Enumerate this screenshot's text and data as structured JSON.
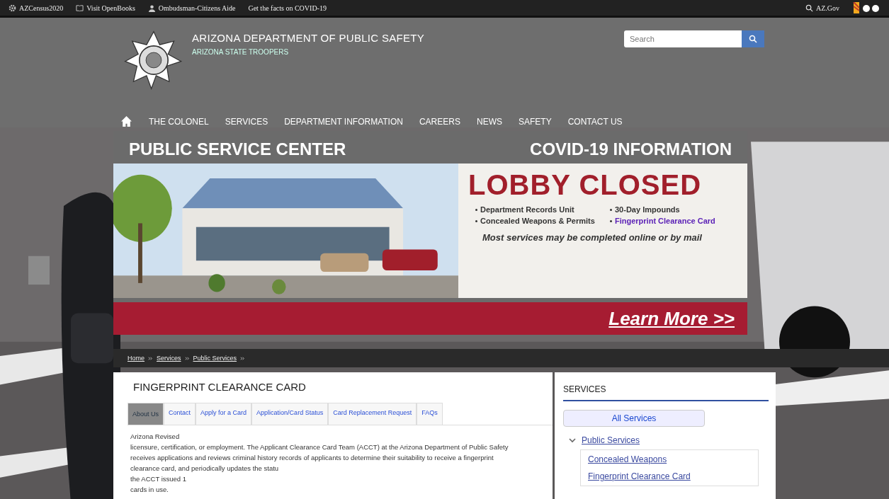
{
  "top_bar": {
    "links": [
      {
        "label": "AZCensus2020"
      },
      {
        "label": "Visit OpenBooks"
      },
      {
        "label": "Ombudsman-Citizens Aide"
      },
      {
        "label": "Get the facts on COVID-19"
      }
    ],
    "right_link": "AZ.Gov"
  },
  "header": {
    "title": "ARIZONA DEPARTMENT OF PUBLIC SAFETY",
    "subtitle": "ARIZONA STATE TROOPERS",
    "search": {
      "placeholder": "Search"
    }
  },
  "nav": {
    "items": [
      "THE COLONEL",
      "SERVICES",
      "DEPARTMENT INFORMATION",
      "CAREERS",
      "NEWS",
      "SAFETY",
      "CONTACT US"
    ]
  },
  "banner": {
    "left_heading": "PUBLIC SERVICE CENTER",
    "right_heading": "COVID-19 INFORMATION",
    "notice": "LOBBY CLOSED",
    "bullets": [
      {
        "text": "Department Records Unit",
        "highlight": false
      },
      {
        "text": "30-Day Impounds",
        "highlight": false
      },
      {
        "text": "Concealed Weapons & Permits",
        "highlight": false
      },
      {
        "text": "Fingerprint Clearance Card",
        "highlight": true
      }
    ],
    "note": "Most services may be completed online or by mail",
    "button": "Learn More >>"
  },
  "breadcrumb": [
    "Home",
    "Services",
    "Public Services"
  ],
  "content": {
    "title": "FINGERPRINT CLEARANCE CARD",
    "tabs": [
      {
        "label": "About Us",
        "selected": true
      },
      {
        "label": "Contact",
        "selected": false
      },
      {
        "label": "Apply for a Card",
        "selected": false
      },
      {
        "label": "Application/Card Status",
        "selected": false
      },
      {
        "label": "Card Replacement Request",
        "selected": false
      },
      {
        "label": "FAQs",
        "selected": false
      }
    ],
    "lines": [
      "Arizona Revised",
      "licensure, certification, or employment.  The Applicant Clearance Card Team (ACCT) at the Arizona Department of Public Safety",
      "receives applications and reviews criminal history records of applicants to determine their suitability to receive a fingerprint",
      "clearance card, and periodically updates the statu",
      "the ACCT issued 1",
      "cards in use."
    ]
  },
  "sidebar": {
    "heading": "SERVICES",
    "button": "All Services",
    "items": [
      {
        "label": "Public Services",
        "expanded": true,
        "children": [
          {
            "label": "Concealed Weapons"
          },
          {
            "label": "Fingerprint Clearance Card"
          }
        ]
      }
    ]
  }
}
